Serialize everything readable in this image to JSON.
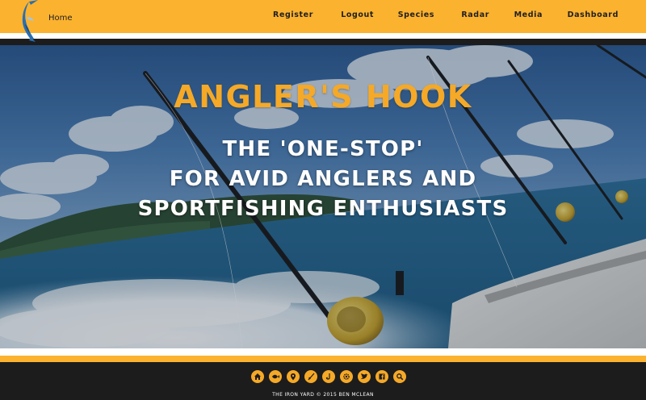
{
  "header": {
    "home_label": "Home",
    "nav": [
      "Register",
      "Logout",
      "Species",
      "Radar",
      "Media",
      "Dashboard"
    ]
  },
  "hero": {
    "title": "ANGLER'S HOOK",
    "subtitle_lines": [
      "THE 'ONE-STOP'",
      "FOR AVID ANGLERS AND",
      "SPORTFISHING ENTHUSIASTS"
    ]
  },
  "footer": {
    "icons": [
      "home-icon",
      "fish-icon",
      "map-pin-icon",
      "fishing-rod-icon",
      "hook-icon",
      "gear-icon",
      "twitter-icon",
      "facebook-icon",
      "search-icon"
    ],
    "copyright": "THE IRON YARD © 2015 BEN MCLEAN"
  },
  "colors": {
    "accent": "#fbb22f",
    "dark": "#1c1c1c",
    "title": "#f5a927"
  }
}
